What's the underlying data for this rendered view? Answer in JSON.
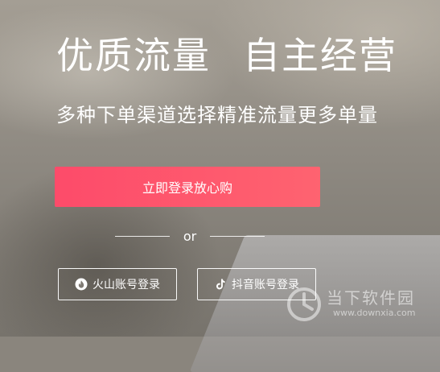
{
  "hero": {
    "title_left": "优质流量",
    "title_right": "自主经营",
    "subtitle": "多种下单渠道选择精准流量更多单量"
  },
  "login": {
    "button_label": "立即登录放心购"
  },
  "divider": {
    "text": "or"
  },
  "social": {
    "huoshan": {
      "label": "火山账号登录",
      "icon": "flame-icon"
    },
    "douyin": {
      "label": "抖音账号登录",
      "icon": "music-note-icon"
    }
  },
  "watermark": {
    "brand": "当下软件园",
    "url": "www.downxia.com"
  },
  "colors": {
    "button_start": "#fd4b6a",
    "button_end": "#fe6370",
    "text": "#ffffff"
  }
}
